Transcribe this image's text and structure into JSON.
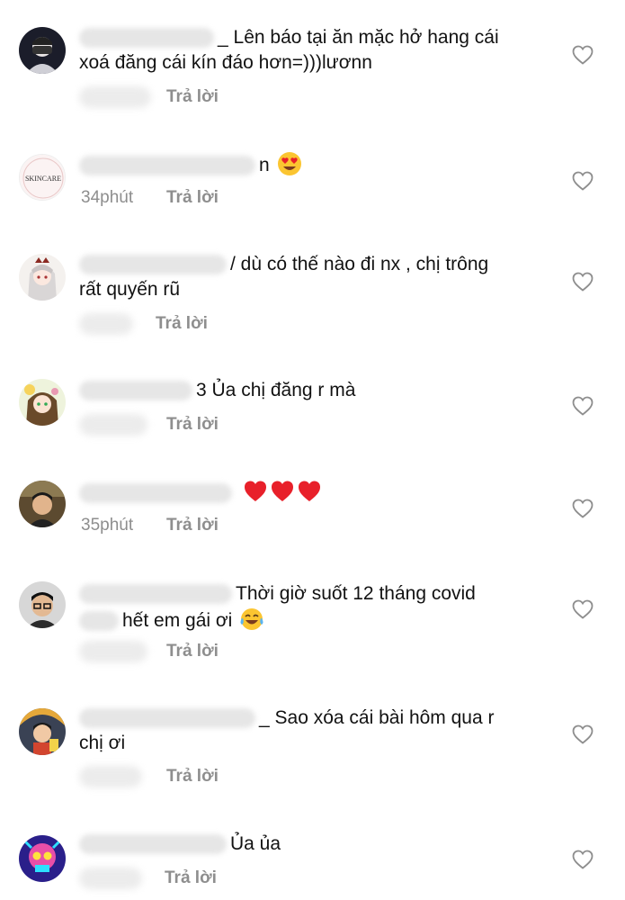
{
  "comments": [
    {
      "text_lines": [
        "_ Lên báo tại ăn mặc hở hang cái",
        "xoá đăng cái kín đáo hơn=)))lươnn"
      ],
      "meta_time": "",
      "reply_label": "Trả lời",
      "avatar_icon": "masked-person-avatar",
      "emojis": []
    },
    {
      "text_lines": [
        "n"
      ],
      "meta_time": "34phút",
      "reply_label": "Trả lời",
      "avatar_icon": "skincare-logo-avatar",
      "avatar_text": "SKINCARE",
      "emojis": [
        "heart-eyes-emoji"
      ]
    },
    {
      "text_lines": [
        "/ dù có thế nào đi nx , chị trông",
        "rất quyến rũ"
      ],
      "meta_time": "",
      "reply_label": "Trả lời",
      "avatar_icon": "anime-girl-avatar",
      "emojis": []
    },
    {
      "text_lines": [
        "3 Ủa chị đăng r mà"
      ],
      "meta_time": "",
      "reply_label": "Trả lời",
      "avatar_icon": "anime-character-avatar",
      "emojis": []
    },
    {
      "text_lines": [
        ""
      ],
      "meta_time": "35phút",
      "reply_label": "Trả lời",
      "avatar_icon": "man-portrait-avatar",
      "emojis": [
        "red-heart-emoji",
        "red-heart-emoji",
        "red-heart-emoji"
      ]
    },
    {
      "text_lines": [
        "Thời giờ suốt 12 tháng covid",
        "hết em gái ơi"
      ],
      "meta_time": "",
      "reply_label": "Trả lời",
      "avatar_icon": "man-glasses-avatar",
      "emojis": [
        "tears-of-joy-emoji"
      ]
    },
    {
      "text_lines": [
        "_ Sao xóa cái bài hôm qua r",
        "chị ơi"
      ],
      "meta_time": "",
      "reply_label": "Trả lời",
      "avatar_icon": "cartoon-boy-avatar",
      "emojis": []
    },
    {
      "text_lines": [
        "Ủa ủa"
      ],
      "meta_time": "",
      "reply_label": "Trả lời",
      "avatar_icon": "neon-skull-avatar",
      "emojis": []
    }
  ],
  "colors": {
    "text": "#121212",
    "meta": "#8e8e8e",
    "heart_outline": "#8e8e8e",
    "emoji_red": "#e8202a",
    "emoji_yellow": "#fbc531"
  }
}
